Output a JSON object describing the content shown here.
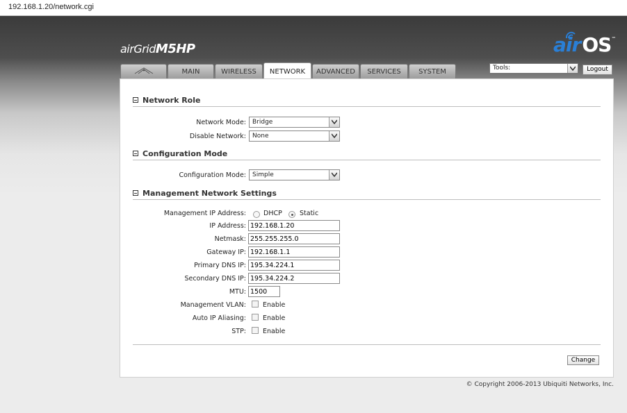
{
  "browser": {
    "url": "192.168.1.20/network.cgi"
  },
  "header": {
    "product": {
      "prefix": "air",
      "mid": "Grid",
      "model": "M5HP"
    },
    "logo": {
      "air": "air",
      "os": "OS",
      "tm": "™"
    }
  },
  "tabs": [
    {
      "label": "",
      "icon": "ubiquiti-logo-icon"
    },
    {
      "label": "MAIN"
    },
    {
      "label": "WIRELESS"
    },
    {
      "label": "NETWORK",
      "active": true
    },
    {
      "label": "ADVANCED"
    },
    {
      "label": "SERVICES"
    },
    {
      "label": "SYSTEM"
    }
  ],
  "tools": {
    "selected": "Tools:",
    "logout": "Logout"
  },
  "sections": {
    "network_role": {
      "title": "Network Role",
      "network_mode": {
        "label": "Network Mode:",
        "value": "Bridge"
      },
      "disable_network": {
        "label": "Disable Network:",
        "value": "None"
      }
    },
    "configuration_mode": {
      "title": "Configuration Mode",
      "mode": {
        "label": "Configuration Mode:",
        "value": "Simple"
      }
    },
    "management": {
      "title": "Management Network Settings",
      "ip_mode": {
        "label": "Management IP Address:",
        "dhcp": "DHCP",
        "static": "Static",
        "selected": "Static"
      },
      "ip_address": {
        "label": "IP Address:",
        "value": "192.168.1.20"
      },
      "netmask": {
        "label": "Netmask:",
        "value": "255.255.255.0"
      },
      "gateway": {
        "label": "Gateway IP:",
        "value": "192.168.1.1"
      },
      "primary_dns": {
        "label": "Primary DNS IP:",
        "value": "195.34.224.1"
      },
      "secondary_dns": {
        "label": "Secondary DNS IP:",
        "value": "195.34.224.2"
      },
      "mtu": {
        "label": "MTU:",
        "value": "1500"
      },
      "vlan": {
        "label": "Management VLAN:",
        "option": "Enable"
      },
      "aliasing": {
        "label": "Auto IP Aliasing:",
        "option": "Enable"
      },
      "stp": {
        "label": "STP:",
        "option": "Enable"
      }
    }
  },
  "actions": {
    "change": "Change"
  },
  "footer": {
    "copyright": "© Copyright 2006-2013 Ubiquiti Networks, Inc."
  },
  "colors": {
    "accent": "#2a7fd6",
    "header_dark": "#3b3b3b",
    "panel_bg": "#ffffff"
  }
}
